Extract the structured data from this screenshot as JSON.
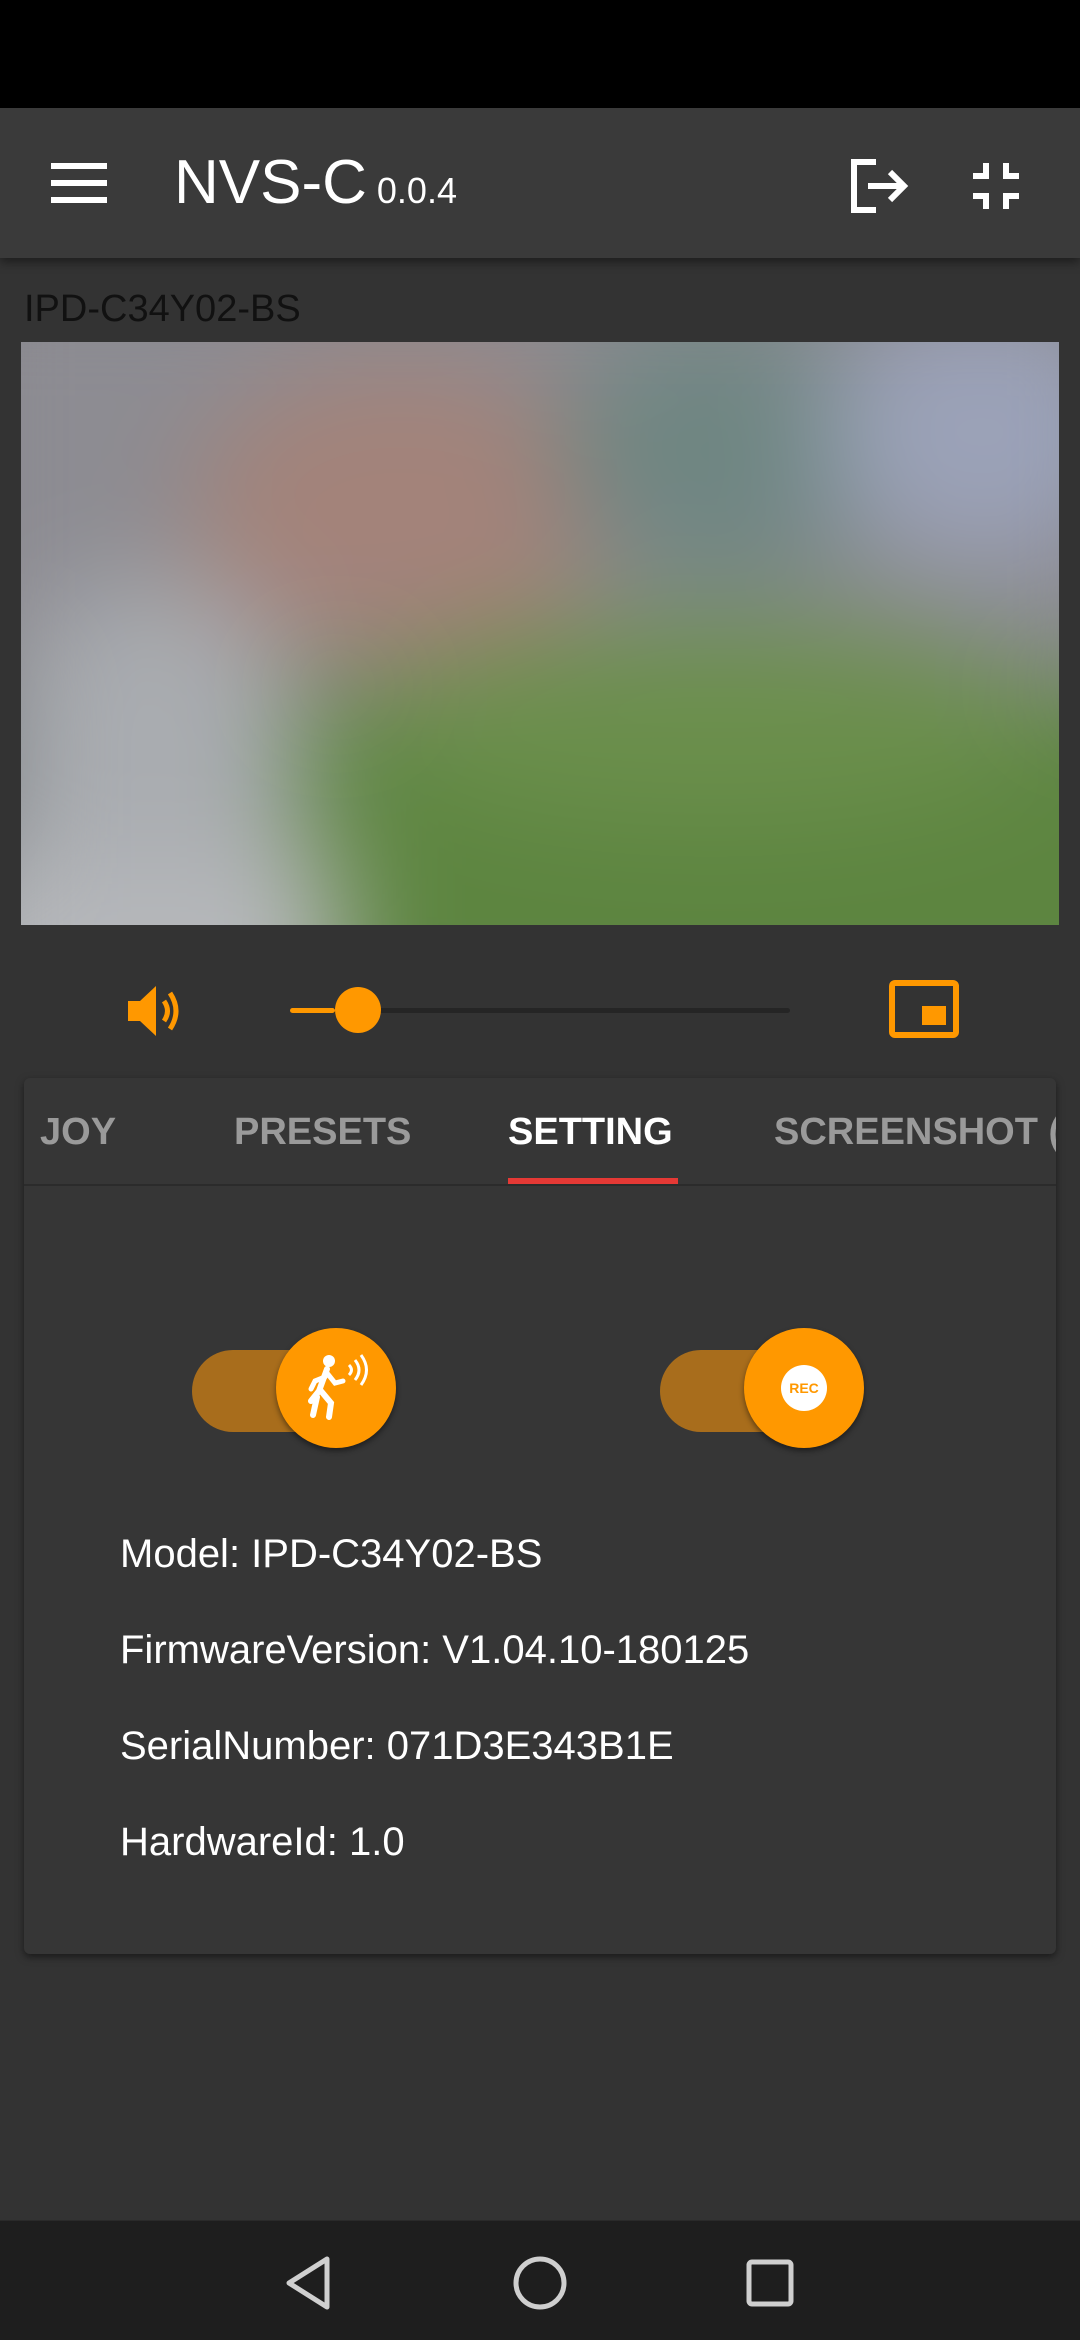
{
  "app_bar": {
    "title": "NVS-C",
    "version": "0.0.4",
    "icons": {
      "menu": "hamburger-menu-icon",
      "exit": "logout-icon",
      "collapse": "fullscreen-exit-icon"
    }
  },
  "camera": {
    "name": "IPD-C34Y02-BS"
  },
  "controls": {
    "volume_icon": "speaker-icon",
    "volume_level": 0.09,
    "pip_icon": "picture-in-picture-icon"
  },
  "tabs": [
    {
      "label": "JOY"
    },
    {
      "label": "PRESETS"
    },
    {
      "label": "SETTING",
      "active": true
    },
    {
      "label": "SCREENSHOT ("
    }
  ],
  "settings": {
    "motion_toggle": {
      "icon": "motion-detection-icon",
      "on": true
    },
    "record_toggle": {
      "icon": "rec-icon",
      "label": "REC",
      "on": true
    },
    "model": "Model: IPD-C34Y02-BS",
    "firmware": "FirmwareVersion: V1.04.10-180125",
    "serial": "SerialNumber: 071D3E343B1E",
    "hardware": "HardwareId: 1.0"
  },
  "nav": {
    "back": "back-icon",
    "home": "home-icon",
    "recents": "recents-icon"
  },
  "colors": {
    "accent": "#ff9800",
    "tab_indicator": "#e53935",
    "background": "#333333",
    "app_bar": "#3a3a3a"
  }
}
